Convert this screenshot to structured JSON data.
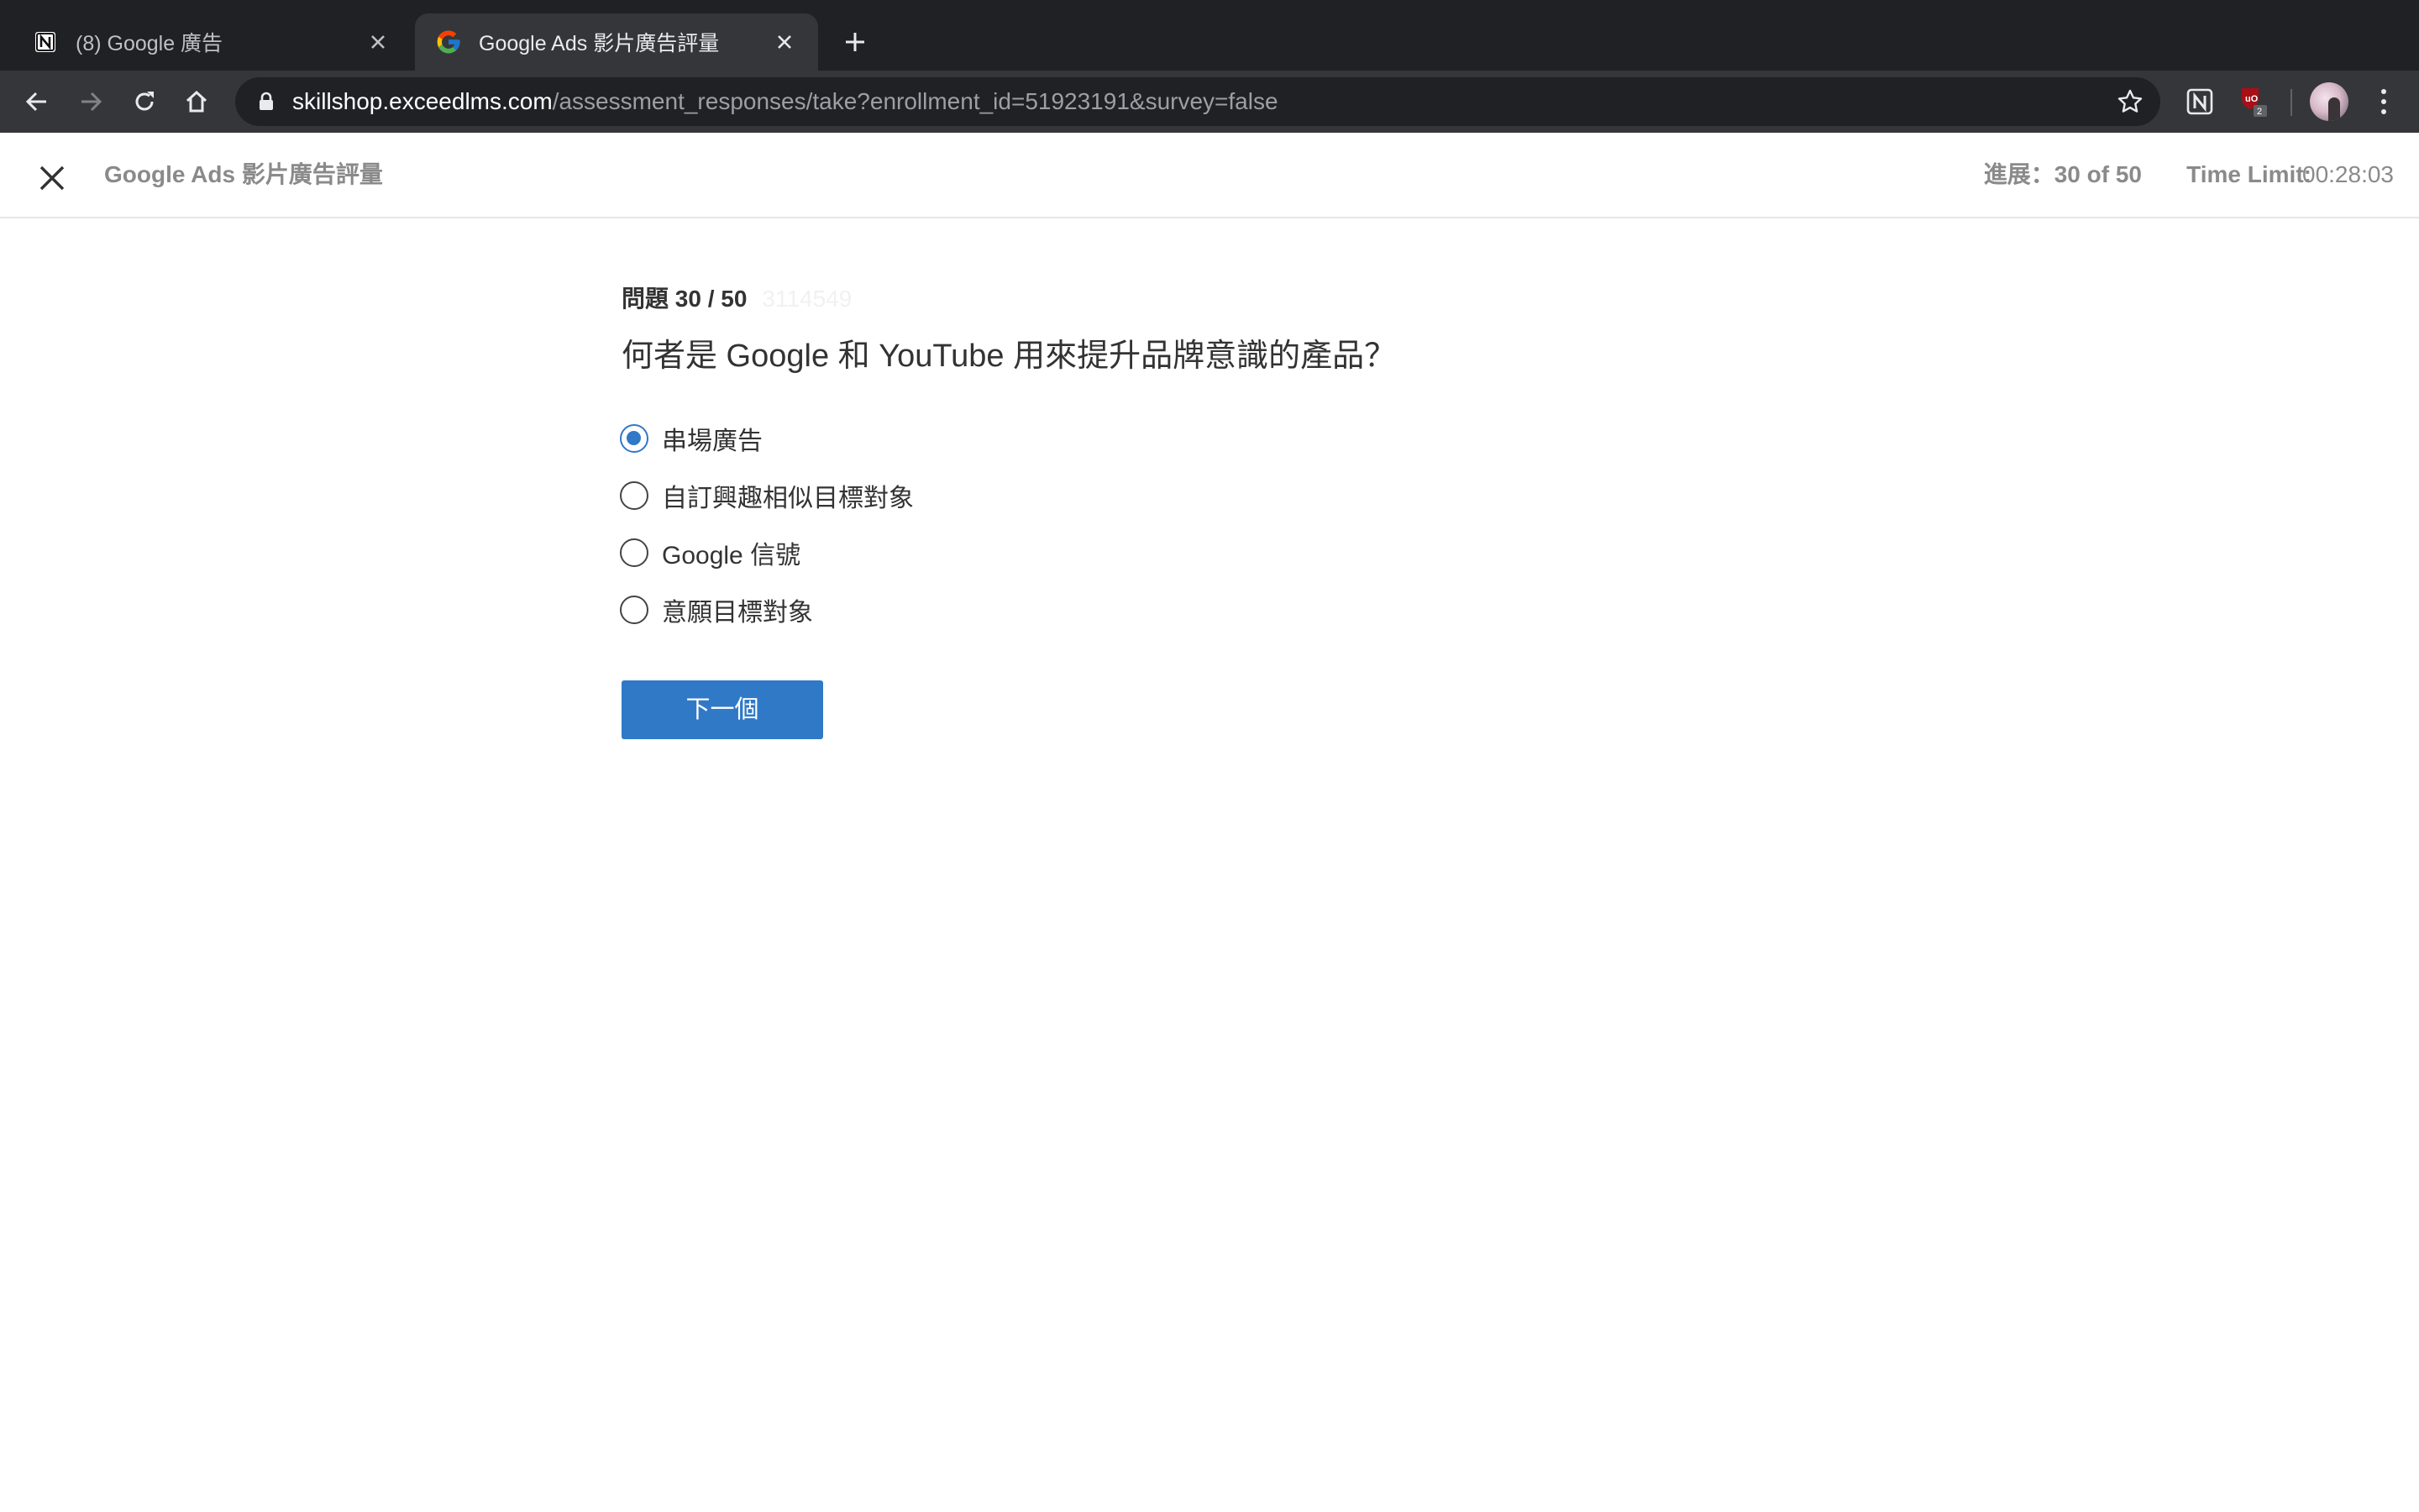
{
  "browser": {
    "tabs": [
      {
        "title": "(8) Google 廣告",
        "favicon": "notion-icon",
        "active": false
      },
      {
        "title": "Google Ads 影片廣告評量",
        "favicon": "google-icon",
        "active": true
      }
    ],
    "url": {
      "host": "skillshop.exceedlms.com",
      "path": "/assessment_responses/take?enrollment_id=51923191&survey=false"
    },
    "extensions": [
      {
        "name": "notion-icon"
      },
      {
        "name": "ublock-icon",
        "badge": "2"
      }
    ]
  },
  "header": {
    "course_title": "Google Ads 影片廣告評量",
    "progress": "進展：30 of 50",
    "time_limit_label": "Time Limit:",
    "time_limit_value": "00:28:03"
  },
  "question": {
    "number_label": "問題 30 / 50",
    "id": "3114549",
    "text": "何者是 Google 和 YouTube 用來提升品牌意識的產品？",
    "options": [
      {
        "label": "串場廣告",
        "selected": true
      },
      {
        "label": "自訂興趣相似目標對象",
        "selected": false
      },
      {
        "label": "Google 信號",
        "selected": false
      },
      {
        "label": "意願目標對象",
        "selected": false
      }
    ]
  },
  "next_button": {
    "label": "下一個"
  },
  "colors": {
    "primary": "#2f79c7",
    "tabstrip": "#202124",
    "toolbar": "#35363a",
    "header_text": "#8a8a8a"
  }
}
